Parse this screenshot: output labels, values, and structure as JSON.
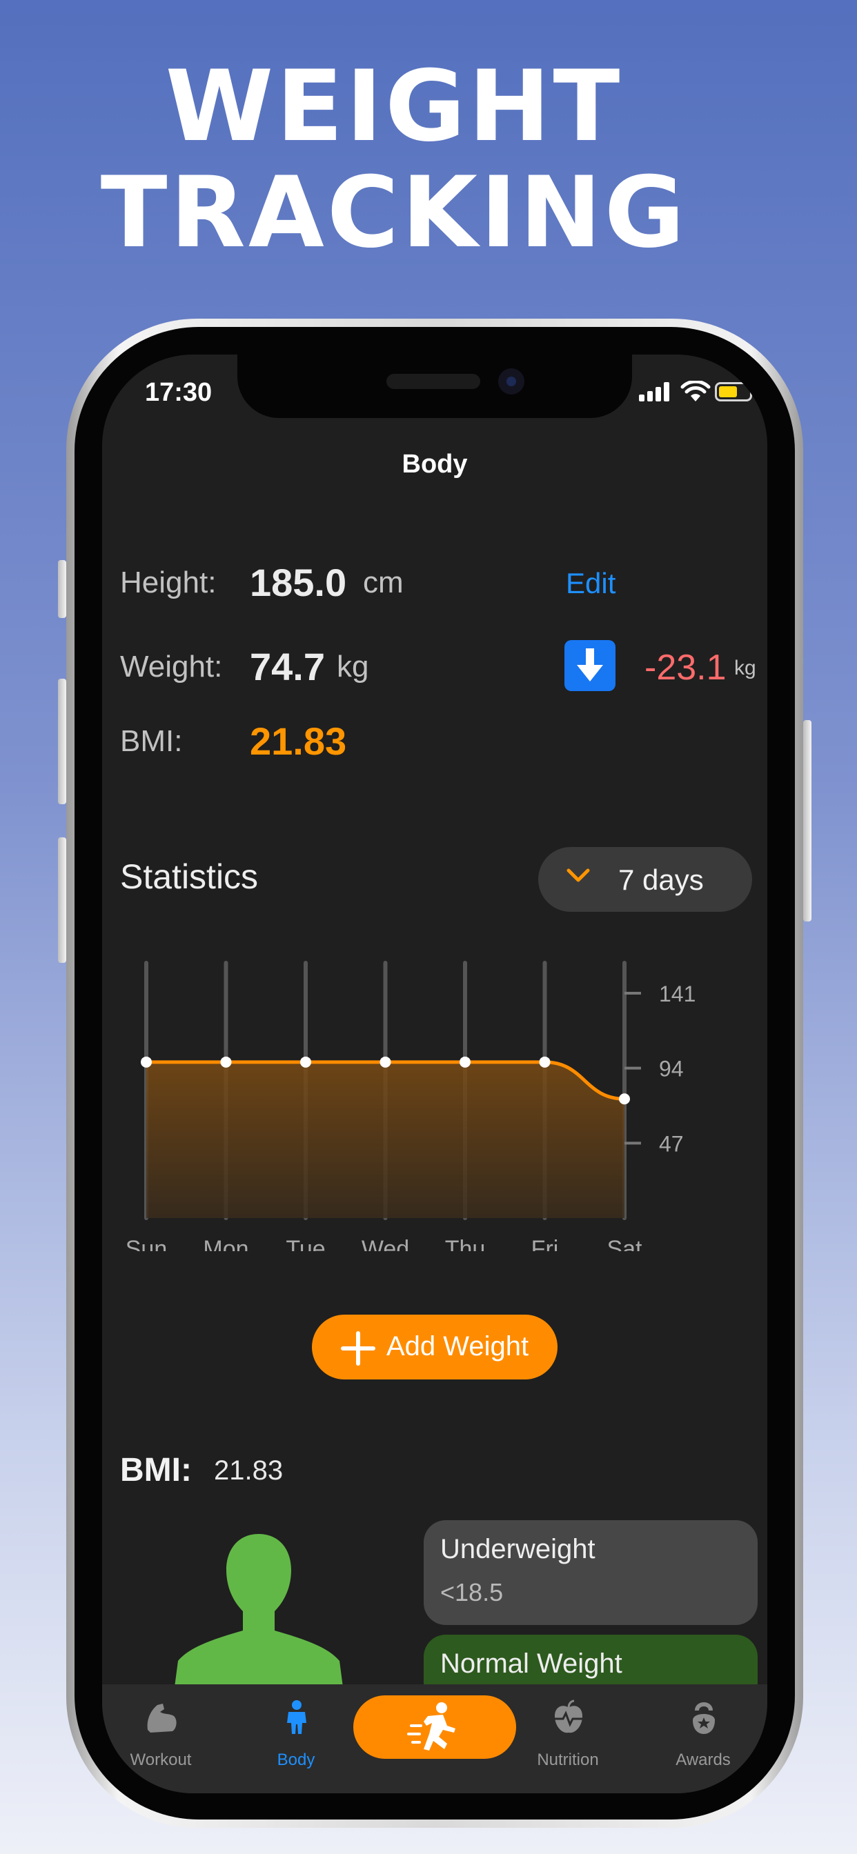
{
  "headline": {
    "line1": "WEIGHT",
    "line2": "TRACKING"
  },
  "status_bar": {
    "time": "17:30"
  },
  "nav": {
    "title": "Body"
  },
  "profile": {
    "height_label": "Height:",
    "height_value": "185.0",
    "height_unit": "cm",
    "edit_label": "Edit",
    "weight_label": "Weight:",
    "weight_value": "74.7",
    "weight_unit": "kg",
    "weight_change": "-23.1",
    "weight_change_unit": "kg",
    "bmi_label": "BMI:",
    "bmi_value": "21.83"
  },
  "statistics": {
    "title": "Statistics",
    "range_label": "7 days"
  },
  "chart_data": {
    "type": "area",
    "categories": [
      "Sun",
      "Mon",
      "Tue",
      "Wed",
      "Thu",
      "Fri",
      "Sat"
    ],
    "values": [
      97.8,
      97.8,
      97.8,
      97.8,
      97.8,
      97.8,
      74.7
    ],
    "y_ticks": [
      47,
      94,
      141
    ],
    "ylim": [
      0,
      160
    ],
    "grid": "vertical",
    "color": "#ff8c00"
  },
  "add_weight": {
    "label": "Add Weight"
  },
  "bmi_section": {
    "label": "BMI:",
    "value": "21.83",
    "cards": [
      {
        "name": "Underweight",
        "range": "<18.5",
        "color": "#474747"
      },
      {
        "name": "Normal Weight",
        "range": "",
        "color": "#2d5a1e"
      }
    ]
  },
  "tabbar": {
    "items": [
      {
        "label": "Workout"
      },
      {
        "label": "Body"
      },
      {
        "label": "Nutrition"
      },
      {
        "label": "Awards"
      }
    ]
  }
}
